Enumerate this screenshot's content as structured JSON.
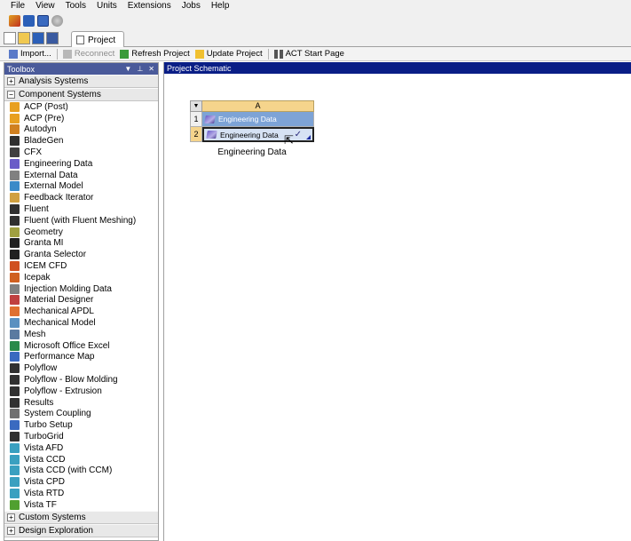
{
  "menubar": {
    "items": [
      "File",
      "View",
      "Tools",
      "Units",
      "Extensions",
      "Jobs",
      "Help"
    ]
  },
  "quick_toolbar": {
    "icons": [
      "workbench-icon",
      "save-icon",
      "save-as-icon",
      "globe-icon"
    ]
  },
  "tabbar": {
    "icons": [
      "new-icon",
      "open-icon",
      "save-icon",
      "save-as-icon"
    ],
    "tab_label": "Project"
  },
  "main_toolbar": {
    "import": "Import...",
    "reconnect": "Reconnect",
    "refresh": "Refresh Project",
    "update": "Update Project",
    "act": "ACT Start Page"
  },
  "toolbox": {
    "title": "Toolbox",
    "groups": {
      "analysis": "Analysis Systems",
      "component": "Component Systems",
      "custom": "Custom Systems",
      "design": "Design Exploration"
    },
    "components": [
      "ACP (Post)",
      "ACP (Pre)",
      "Autodyn",
      "BladeGen",
      "CFX",
      "Engineering Data",
      "External Data",
      "External Model",
      "Feedback Iterator",
      "Fluent",
      "Fluent (with Fluent Meshing)",
      "Geometry",
      "Granta MI",
      "Granta Selector",
      "ICEM CFD",
      "Icepak",
      "Injection Molding Data",
      "Material Designer",
      "Mechanical APDL",
      "Mechanical Model",
      "Mesh",
      "Microsoft Office Excel",
      "Performance Map",
      "Polyflow",
      "Polyflow - Blow Molding",
      "Polyflow - Extrusion",
      "Results",
      "System Coupling",
      "Turbo Setup",
      "TurboGrid",
      "Vista AFD",
      "Vista CCD",
      "Vista CCD (with CCM)",
      "Vista CPD",
      "Vista RTD",
      "Vista TF"
    ]
  },
  "schematic": {
    "title": "Project Schematic",
    "system": {
      "column": "A",
      "rows": [
        {
          "num": "1",
          "label": "Engineering Data"
        },
        {
          "num": "2",
          "label": "Engineering Data",
          "status": "✓"
        }
      ],
      "caption": "Engineering Data"
    }
  },
  "colors": {
    "schematic_header": "#0a1e86",
    "toolbox_header": "#4a5a9a",
    "cell_highlight": "#7da3d6",
    "column_header": "#f5d48c"
  }
}
